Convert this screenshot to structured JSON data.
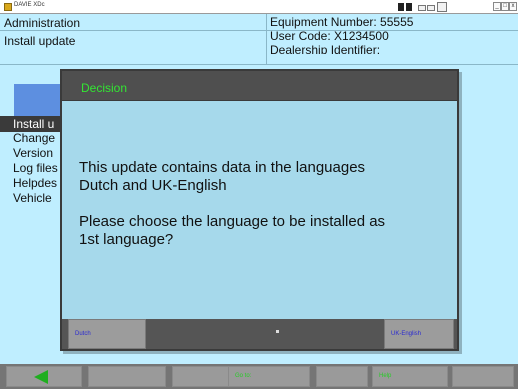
{
  "window": {
    "title": "DAVIE XDc",
    "controls": [
      "_",
      "□",
      "x"
    ]
  },
  "header": {
    "breadcrumb": [
      "Administration",
      "Install update"
    ],
    "info": {
      "equipment_number": "Equipment Number:   55555",
      "user_code": "User Code:   X1234500",
      "dealership": "Dealership Identifier:"
    }
  },
  "menu": {
    "items": [
      "Install u",
      "Change",
      "Version",
      "Log files",
      "Helpdes",
      "Vehicle"
    ]
  },
  "dialog": {
    "title": "Decision",
    "lines": [
      "This update contains data in the languages",
      "Dutch and UK-English",
      "",
      "Please choose the language to be installed as",
      "1st language?"
    ],
    "buttons": {
      "dutch": "Dutch",
      "uk_english": "UK-English"
    }
  },
  "toolbar": {
    "goto_label": "Go to:",
    "help_label": "Help"
  },
  "colors": {
    "panel": "#bfeeff",
    "dialog_bg": "#a6d9eb",
    "dialog_header": "#4f4f4f",
    "title_green": "#33e633",
    "accent_blue": "#5d8fe0",
    "button_text": "#2a2ad0",
    "bottom_bar": "#757575"
  },
  "icons": [
    "app-icon",
    "back-arrow-icon",
    "minimize-icon",
    "maximize-icon",
    "close-icon"
  ]
}
